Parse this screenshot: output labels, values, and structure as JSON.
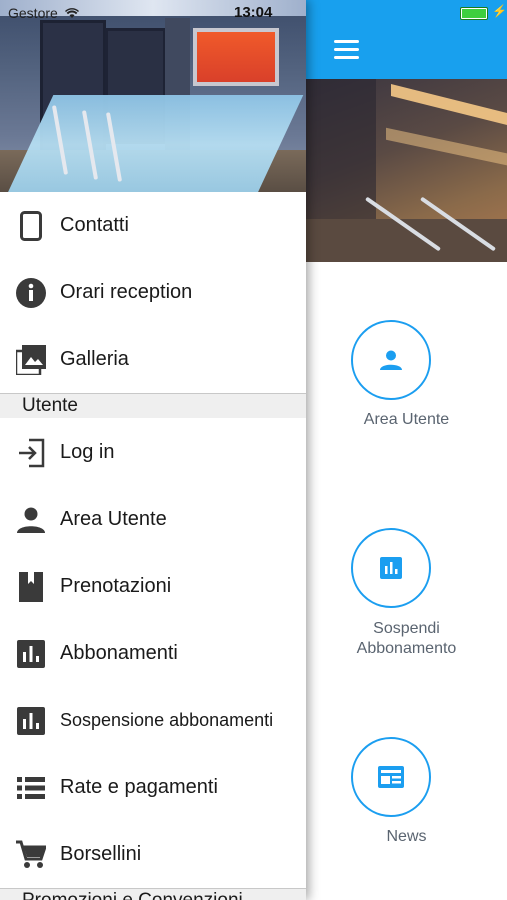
{
  "status_bar": {
    "carrier": "Gestore",
    "time": "13:04"
  },
  "drawer": {
    "items_top": [
      {
        "label": "Contatti",
        "icon": "phone-icon"
      },
      {
        "label": "Orari reception",
        "icon": "info-icon"
      },
      {
        "label": "Galleria",
        "icon": "gallery-icon"
      }
    ],
    "section_user": "Utente",
    "items_user": [
      {
        "label": "Log in",
        "icon": "login-icon"
      },
      {
        "label": "Area Utente",
        "icon": "person-icon"
      },
      {
        "label": "Prenotazioni",
        "icon": "bookmark-icon"
      },
      {
        "label": "Abbonamenti",
        "icon": "bar-chart-icon"
      },
      {
        "label": "Sospensione abbonamenti",
        "icon": "bar-chart-icon"
      },
      {
        "label": "Rate e pagamenti",
        "icon": "list-icon"
      },
      {
        "label": "Borsellini",
        "icon": "cart-icon"
      }
    ],
    "section_promo": "Promozioni e Convenzioni"
  },
  "main": {
    "tiles": [
      {
        "label": "Area Utente",
        "icon": "person-icon"
      },
      {
        "label_line1": "Sospendi",
        "label_line2": "Abbonamento",
        "icon": "bar-chart-icon"
      },
      {
        "label": "News",
        "icon": "news-icon"
      }
    ]
  },
  "colors": {
    "accent": "#18a0ee",
    "icon_dark": "#3a3a3a"
  }
}
